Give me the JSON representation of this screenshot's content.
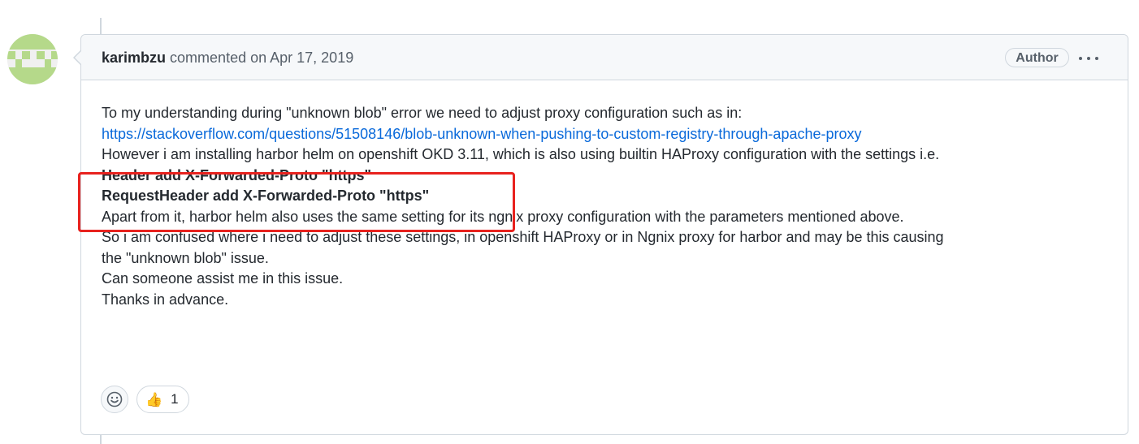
{
  "comment": {
    "author": "karimbzu",
    "action": "commented on",
    "date": "Apr 17, 2019",
    "badge": "Author",
    "body": {
      "line1": "To my understanding during \"unknown blob\" error we need to adjust proxy configuration such as in:",
      "link": "https://stackoverflow.com/questions/51508146/blob-unknown-when-pushing-to-custom-registry-through-apache-proxy",
      "line3": "However i am installing harbor helm on openshift OKD 3.11, which is also using builtin HAProxy configuration with the settings i.e.",
      "bold1": "Header add X-Forwarded-Proto \"https\"",
      "bold2": "RequestHeader add X-Forwarded-Proto \"https\"",
      "line6": "Apart from it, harbor helm also uses the same setting for its ngnix proxy configuration with the parameters mentioned above.",
      "line7": "So i am confused where i need to adjust these settings, in openshift HAProxy or in Ngnix proxy for harbor and may be this causing",
      "line8": "the \"unknown blob\" issue.",
      "line9": "Can someone assist me in this issue.",
      "line10": "Thanks in advance."
    },
    "reactions": [
      {
        "icon": "thumbs-up-icon",
        "glyph": "👍",
        "count": "1"
      }
    ]
  },
  "colors": {
    "highlight": "#e8221e",
    "link": "#0969da",
    "avatar_green": "#b5d98a"
  }
}
